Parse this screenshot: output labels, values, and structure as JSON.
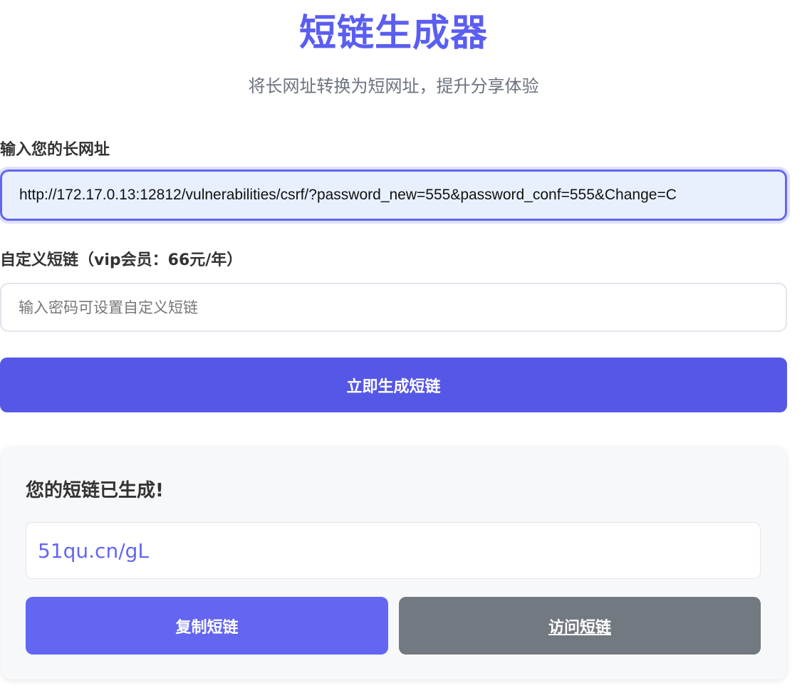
{
  "header": {
    "title": "短链生成器",
    "subtitle": "将长网址转换为短网址，提升分享体验"
  },
  "form": {
    "url_label": "输入您的长网址",
    "url_value": "http://172.17.0.13:12812/vulnerabilities/csrf/?password_new=555&password_conf=555&Change=C",
    "custom_label": "自定义短链（vip会员：66元/年）",
    "custom_placeholder": "输入密码可设置自定义短链",
    "custom_value": "",
    "generate_label": "立即生成短链"
  },
  "result": {
    "heading": "您的短链已生成!",
    "short_link": "51qu.cn/gL",
    "copy_label": "复制短链",
    "visit_label": "访问短链"
  },
  "colors": {
    "accent": "#6366f1",
    "primary_button": "#5558e6",
    "secondary_button": "#737980",
    "url_field_bg": "#e8f0fe",
    "card_bg": "#f7f8fa"
  }
}
